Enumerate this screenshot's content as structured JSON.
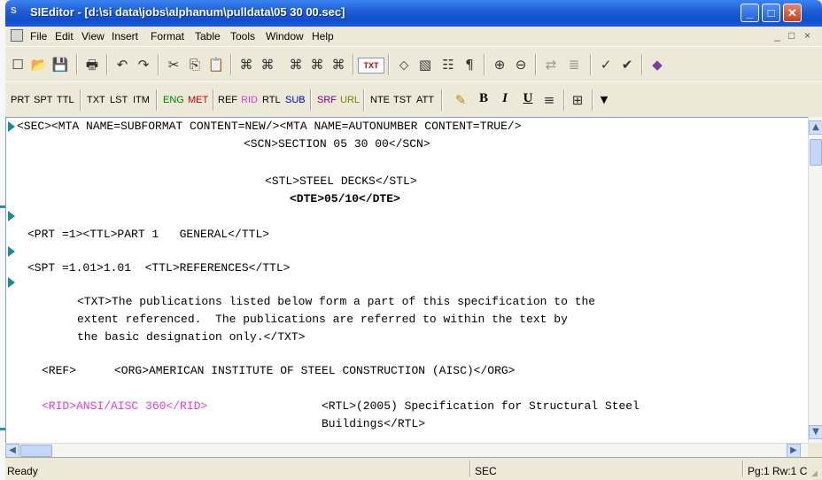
{
  "window": {
    "app_icon": "S",
    "title": "SIEditor - [d:\\si data\\jobs\\alphanum\\pulldata\\05 30 00.sec]"
  },
  "menu": {
    "items": [
      "File",
      "Edit",
      "View",
      "Insert",
      "Format",
      "Table",
      "Tools",
      "Window",
      "Help"
    ],
    "mdi_controls": [
      "_",
      "□",
      "×"
    ]
  },
  "toolbar1": {
    "icons": [
      {
        "name": "new-icon",
        "glyph": "☐"
      },
      {
        "name": "open-icon",
        "glyph": "📂"
      },
      {
        "name": "save-icon",
        "glyph": "💾"
      },
      {
        "name": "print-icon",
        "glyph": "🖶"
      },
      {
        "name": "undo-icon",
        "glyph": "↶"
      },
      {
        "name": "redo-icon",
        "glyph": "↷"
      },
      {
        "name": "cut-icon",
        "glyph": "✂"
      },
      {
        "name": "copy-icon",
        "glyph": "⎘"
      },
      {
        "name": "paste-icon",
        "glyph": "📋"
      },
      {
        "name": "find-icon",
        "glyph": "⌘"
      },
      {
        "name": "find-next-icon",
        "glyph": "⌘"
      },
      {
        "name": "find-replace-icon",
        "glyph": "⌘"
      },
      {
        "name": "find-tag-icon",
        "glyph": "⌘"
      },
      {
        "name": "find-all-icon",
        "glyph": "⌘"
      },
      {
        "name": "text-mode-icon",
        "glyph": "TXT"
      },
      {
        "name": "insert-object-icon",
        "glyph": "⬦"
      },
      {
        "name": "insert-image-icon",
        "glyph": "▧"
      },
      {
        "name": "text-tag-icon",
        "glyph": "☷"
      },
      {
        "name": "pilcrow-icon",
        "glyph": "¶"
      },
      {
        "name": "zoom-in-icon",
        "glyph": "⊕"
      },
      {
        "name": "zoom-out-icon",
        "glyph": "⊖"
      },
      {
        "name": "renumber-icon",
        "glyph": "⇄"
      },
      {
        "name": "list-icon",
        "glyph": "≣"
      },
      {
        "name": "spell-check-icon",
        "glyph": "✓"
      },
      {
        "name": "validate-icon",
        "glyph": "✔"
      },
      {
        "name": "book-icon",
        "glyph": "◆"
      }
    ]
  },
  "toolbar2": {
    "tags": [
      {
        "label": "PRT",
        "color": "#000000"
      },
      {
        "label": "SPT",
        "color": "#000000"
      },
      {
        "label": "TTL",
        "color": "#000000"
      },
      {
        "label": "TXT",
        "color": "#000000"
      },
      {
        "label": "LST",
        "color": "#000000"
      },
      {
        "label": "ITM",
        "color": "#000000"
      },
      {
        "label": "ENG",
        "color": "#008000"
      },
      {
        "label": "MET",
        "color": "#c00000"
      },
      {
        "label": "REF",
        "color": "#000000"
      },
      {
        "label": "RID",
        "color": "#e03cd6"
      },
      {
        "label": "RTL",
        "color": "#000000"
      },
      {
        "label": "SUB",
        "color": "#0000c0"
      },
      {
        "label": "SRF",
        "color": "#800080"
      },
      {
        "label": "URL",
        "color": "#808000"
      },
      {
        "label": "NTE",
        "color": "#000000"
      },
      {
        "label": "TST",
        "color": "#000000"
      },
      {
        "label": "ATT",
        "color": "#000000"
      }
    ],
    "format_icons": [
      {
        "name": "highlight-icon",
        "glyph": "✎"
      },
      {
        "name": "bold-icon",
        "glyph": "B"
      },
      {
        "name": "italic-icon",
        "glyph": "I"
      },
      {
        "name": "underline-icon",
        "glyph": "U"
      },
      {
        "name": "align-icon",
        "glyph": "≡"
      },
      {
        "name": "table-icon",
        "glyph": "⊞"
      },
      {
        "name": "dropdown-arrow-icon",
        "glyph": "▼"
      }
    ]
  },
  "editor": {
    "lines": [
      {
        "text": "<SEC><MTA NAME=SUBFORMAT CONTENT=NEW/><MTA NAME=AUTONUMBER CONTENT=TRUE/>",
        "style": "normal"
      },
      {
        "text": "<SCN>SECTION 05 30 00</SCN>",
        "style": "normal"
      },
      {
        "text": "<STL>STEEL DECKS</STL>",
        "style": "normal"
      },
      {
        "text": "<DTE>05/10</DTE>",
        "style": "bold"
      },
      {
        "text": "<PRT =1><TTL>PART 1   GENERAL</TTL>",
        "style": "normal"
      },
      {
        "text": "<SPT =1.01>1.01  <TTL>REFERENCES</TTL>",
        "style": "normal"
      },
      {
        "text": "<TXT>The publications listed below form a part of this specification to the",
        "style": "normal"
      },
      {
        "text": "extent referenced.  The publications are referred to within the text by",
        "style": "normal"
      },
      {
        "text": "the basic designation only.</TXT>",
        "style": "normal"
      },
      {
        "text": "<REF>",
        "style": "normal"
      },
      {
        "text": "<ORG>AMERICAN INSTITUTE OF STEEL CONSTRUCTION (AISC)</ORG>",
        "style": "normal"
      },
      {
        "text": "<RID>ANSI/AISC 360</RID>",
        "style": "rid"
      },
      {
        "text": "<RTL>(2005) Specification for Structural Steel",
        "style": "normal"
      },
      {
        "text": "Buildings</RTL>",
        "style": "normal"
      }
    ]
  },
  "scrollbars": {
    "up_arrow": "▲",
    "down_arrow": "▼",
    "left_arrow": "◀",
    "right_arrow": "▶"
  },
  "statusbar": {
    "state": "Ready",
    "tag": "SEC",
    "position": "Pg:1 Rw:1 C"
  },
  "colors": {
    "rid": "#e03cd6",
    "marker": "#1a8a9a"
  }
}
